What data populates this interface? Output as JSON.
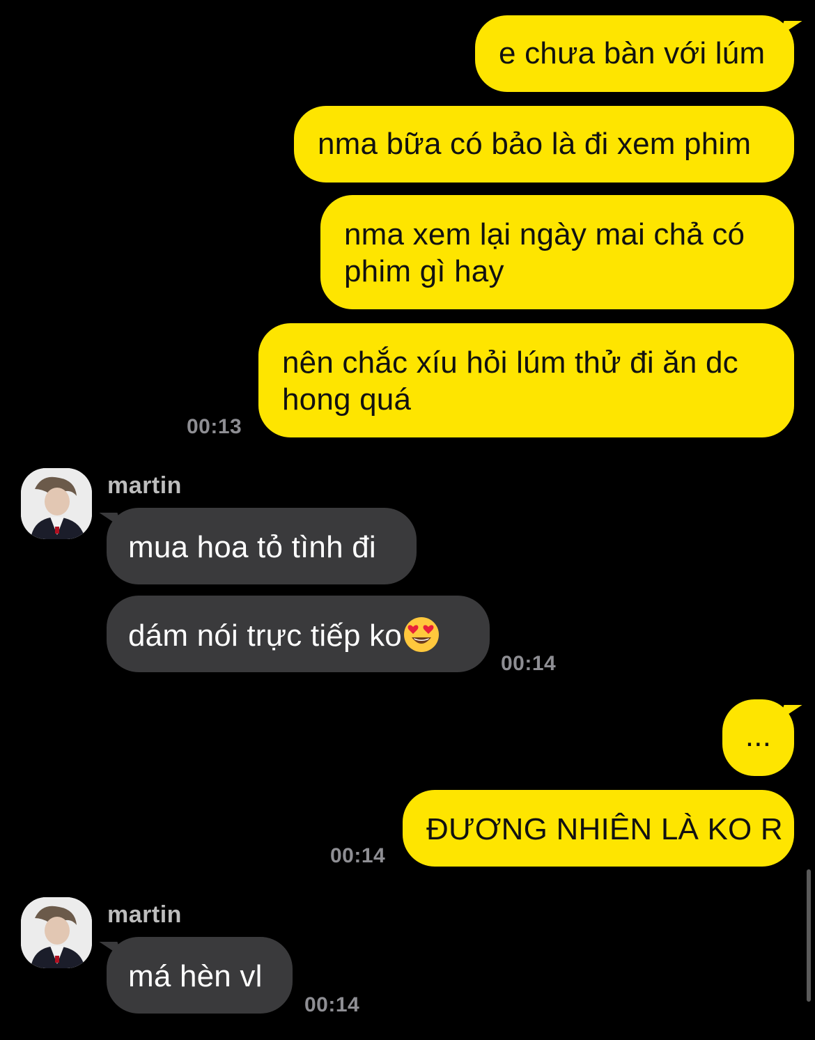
{
  "messages": {
    "m1": "e chưa bàn với lúm",
    "m2": "nma bữa có bảo là đi xem phim",
    "m3_line1": "nma xem lại ngày mai chả có",
    "m3_line2": "phim gì hay",
    "m4_line1": "nên chắc xíu hỏi lúm thử đi ăn dc",
    "m4_line2": "hong quá",
    "time1": "00:13",
    "sender1": "martin",
    "m5": "mua hoa tỏ tình đi",
    "m6": "dám nói trực tiếp ko",
    "time2": "00:14",
    "m7": "...",
    "m8": "ĐƯƠNG NHIÊN LÀ KO R",
    "time3": "00:14",
    "sender2": "martin",
    "m9": "má hèn vl",
    "time4": "00:14"
  },
  "colors": {
    "outgoing_bubble": "#FEE500",
    "incoming_bubble": "#3A3A3C",
    "background": "#000000",
    "timestamp": "#8E8E93"
  },
  "icons": {
    "emoji": "heart-eyes-emoji",
    "avatar": "user-avatar-photo"
  }
}
